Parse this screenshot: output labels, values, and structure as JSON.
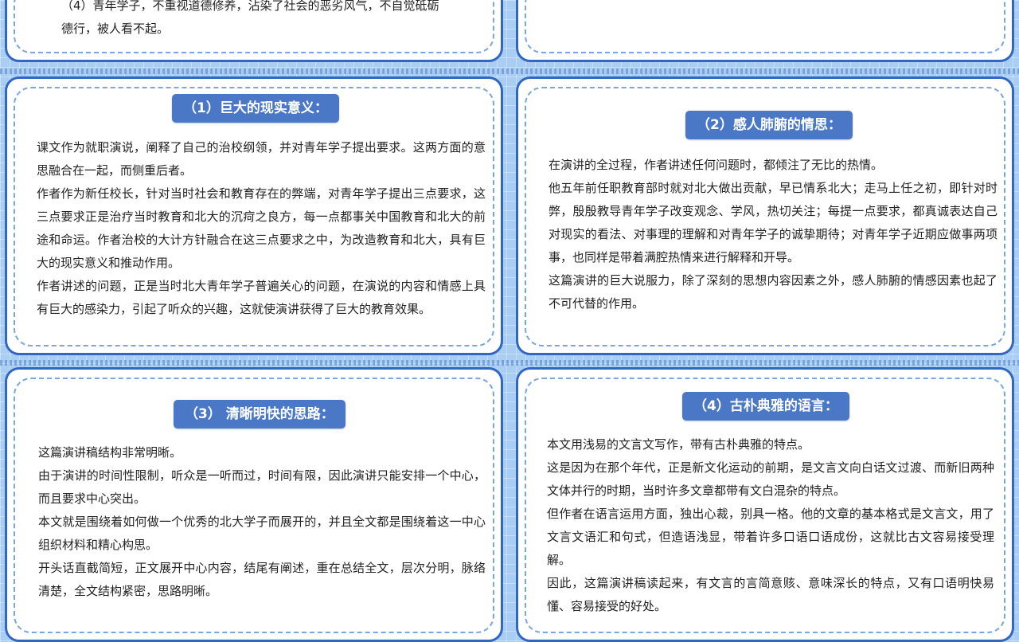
{
  "cards": {
    "top_left": {
      "partial_lines": [
        "（4）青年学子，不重视道德修养，沾染了社会的恶劣风气，不自觉砥砺",
        "德行，被人看不起。"
      ]
    },
    "card1": {
      "title": "（1）巨大的现实意义：",
      "paragraphs": [
        "课文作为就职演说，阐释了自己的治校纲领，并对青年学子提出要求。这两方面的意思融合在一起，而侧重后者。",
        "作者作为新任校长，针对当时社会和教育存在的弊端，对青年学子提出三点要求，这三点要求正是治疗当时教育和北大的沉疴之良方，每一点都事关中国教育和北大的前途和命运。作者治校的大计方针融合在这三点要求之中，为改造教育和北大，具有巨大的现实意义和推动作用。",
        "作者讲述的问题，正是当时北大青年学子普遍关心的问题，在演说的内容和情感上具有巨大的感染力，引起了听众的兴趣，这就使演讲获得了巨大的教育效果。"
      ]
    },
    "card2": {
      "title": "（2）感人肺腑的情思：",
      "paragraphs": [
        "在演讲的全过程，作者讲述任何问题时，都倾注了无比的热情。",
        "他五年前任职教育部时就对北大做出贡献，早已情系北大；走马上任之初，即针对时弊，殷殷教导青年学子改变观念、学风，热切关注；每提一点要求，都真诚表达自己对现实的看法、对事理的理解和对青年学子的诚挚期待；对青年学子近期应做事两项事，也同样是带着满腔热情来进行解释和开导。",
        "这篇演讲的巨大说服力，除了深刻的思想内容因素之外，感人肺腑的情感因素也起了不可代替的作用。"
      ]
    },
    "card3": {
      "title": "（3） 清晰明快的思路：",
      "paragraphs": [
        "这篇演讲稿结构非常明晰。",
        "由于演讲的时间性限制，听众是一听而过，时间有限，因此演讲只能安排一个中心，而且要求中心突出。",
        "本文就是围绕着如何做一个优秀的北大学子而展开的，并且全文都是围绕着这一中心组织材料和精心构思。",
        "开头话直截简短，正文展开中心内容，结尾有阐述，重在总结全文，层次分明，脉络清楚，全文结构紧密，思路明晰。"
      ]
    },
    "card4": {
      "title": "（4）古朴典雅的语言：",
      "paragraphs": [
        "本文用浅易的文言文写作，带有古朴典雅的特点。",
        "这是因为在那个年代，正是新文化运动的前期，是文言文向白话文过渡、而新旧两种文体并行的时期，当时许多文章都带有文白混杂的特点。",
        "但作者在语言运用方面，独出心裁，别具一格。他的文章的基本格式是文言文，用了文言文语汇和句式，但造语浅显，带着许多口语口语成份，这就比古文容易接受理解。",
        "因此，这篇演讲稿读起来，有文言的言简意赅、意味深长的特点，又有口语明快易懂、容易接受的好处。"
      ]
    }
  }
}
